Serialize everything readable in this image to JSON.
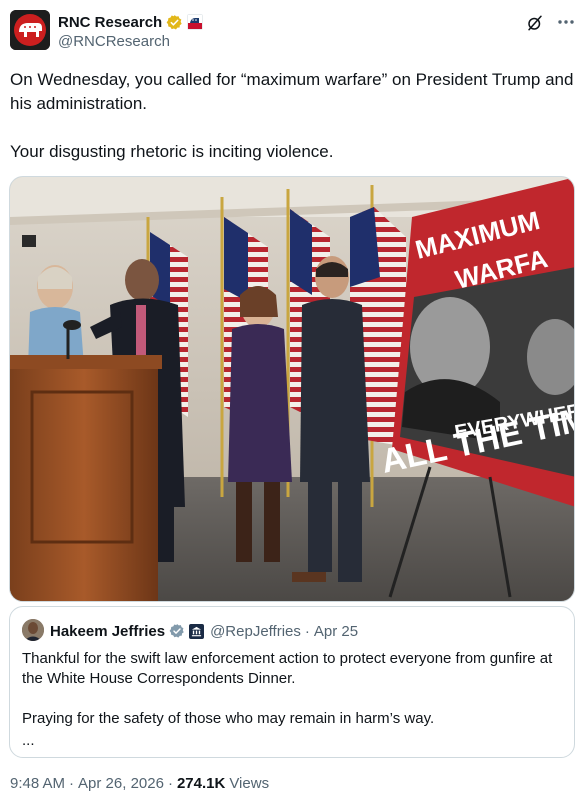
{
  "author": {
    "display_name": "RNC Research",
    "handle": "@RNCResearch",
    "avatar_icon": "gop-elephant-icon",
    "verified_color": "#e2b719"
  },
  "tweet": {
    "paragraph1": "On Wednesday, you called for “maximum warfare” on President Trump and his administration.",
    "paragraph2": "Your disgusting rhetoric is inciting violence."
  },
  "media": {
    "sign_text": [
      "MAXIMUM",
      "WARFA",
      "EVERYWHER",
      "ALL THE TIME"
    ]
  },
  "quoted": {
    "display_name": "Hakeem Jeffries",
    "handle": "@RepJeffries",
    "separator": "·",
    "date": "Apr 25",
    "text1": "Thankful for the swift law enforcement action to protect everyone from gunfire at the White House Correspondents Dinner.",
    "text2": "Praying for the safety of those who may remain in harm’s way.",
    "ellipsis": "..."
  },
  "meta": {
    "time": "9:48 AM",
    "separator": "·",
    "date": "Apr 26, 2026",
    "views_count": "274.1K",
    "views_label": "Views"
  },
  "colors": {
    "text_primary": "#0f1419",
    "text_secondary": "#536471",
    "border": "#cfd9de"
  }
}
